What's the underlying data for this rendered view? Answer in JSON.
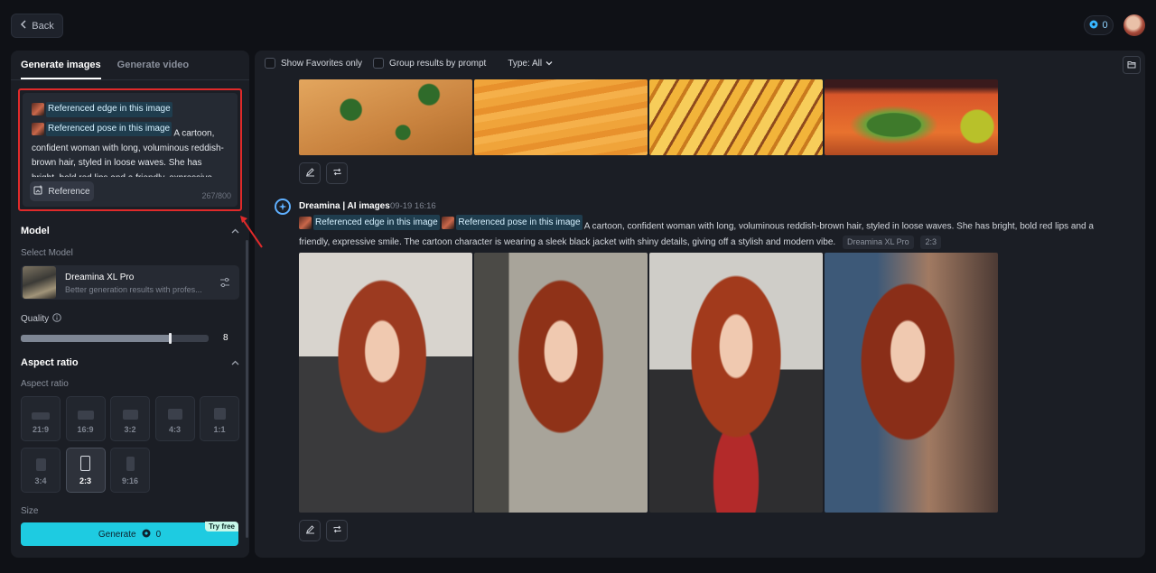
{
  "topbar": {
    "back_label": "Back",
    "credits": "0"
  },
  "left": {
    "tabs": [
      {
        "label": "Generate images"
      },
      {
        "label": "Generate video"
      }
    ],
    "prompt": {
      "ref1": "Referenced edge in this image",
      "ref2": "Referenced pose in this image",
      "text": "A cartoon, confident woman with long, voluminous reddish-brown hair, styled in loose waves. She has bright, bold red lips and a friendly, expressive",
      "reference_label": "Reference",
      "char_count": "267/800"
    },
    "model": {
      "section_title": "Model",
      "select_label": "Select Model",
      "name": "Dreamina XL Pro",
      "desc": "Better generation results with profes..."
    },
    "quality": {
      "label": "Quality",
      "value": "8",
      "fraction": 0.8
    },
    "aspect": {
      "section_title": "Aspect ratio",
      "sub_label": "Aspect ratio",
      "options": [
        "21:9",
        "16:9",
        "3:2",
        "4:3",
        "1:1",
        "3:4",
        "2:3",
        "9:16"
      ],
      "selected": "2:3"
    },
    "size_label": "Size",
    "generate": {
      "label": "Generate",
      "cost": "0",
      "badge": "Try free"
    }
  },
  "main": {
    "filters": {
      "favorites_label": "Show Favorites only",
      "group_label": "Group results by prompt",
      "type_label": "Type: All"
    },
    "generation": {
      "title": "Dreamina | AI images",
      "time": "09-19  16:16",
      "ref1": "Referenced edge in this image",
      "ref2": "Referenced pose in this image",
      "prompt": "A cartoon, confident woman with long, voluminous reddish-brown hair, styled in loose waves. She has bright, bold red lips and a friendly, expressive smile. The cartoon character is wearing a sleek black jacket with shiny details, giving off a stylish and modern vibe.",
      "tags": [
        "Dreamina XL Pro",
        "2:3"
      ]
    }
  },
  "colors": {
    "accent": "#1ecbe1",
    "highlight_border": "#e02a2a",
    "panel": "#1b1e25"
  }
}
